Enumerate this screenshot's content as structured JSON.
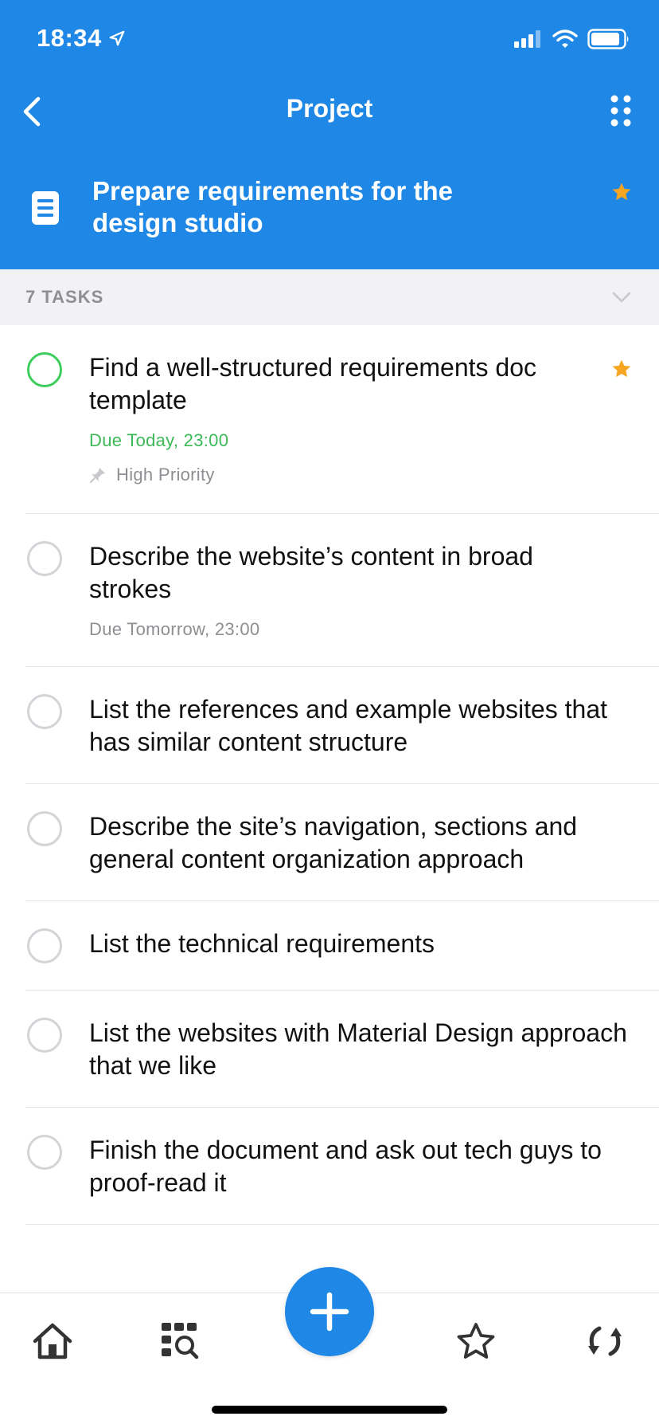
{
  "status_bar": {
    "time": "18:34"
  },
  "nav": {
    "title": "Project"
  },
  "project": {
    "title": "Prepare requirements for the design studio",
    "starred": true
  },
  "tasks_header": {
    "count_label": "7 TASKS"
  },
  "tasks": [
    {
      "text": "Find a well-structured requirements doc template",
      "due": "Due Today, 23:00",
      "priority": "High Priority",
      "starred": true
    },
    {
      "text": "Describe the website’s content in broad strokes",
      "due": "Due Tomorrow, 23:00"
    },
    {
      "text": "List the references and example websites that has similar content structure"
    },
    {
      "text": "Describe the site’s navigation, sections and general content organization approach"
    },
    {
      "text": "List the technical requirements"
    },
    {
      "text": "List the websites with Material Design approach that we like"
    },
    {
      "text": "Finish the document and ask out tech guys to proof-read it"
    }
  ],
  "tab_bar": {
    "items": [
      "home-icon",
      "search-filter-icon",
      "add-icon",
      "star-icon",
      "sync-icon"
    ]
  },
  "colors": {
    "primary": "#1f87e5",
    "accent_star": "#f6a623",
    "due_today": "#3cba57",
    "checkbox_active": "#3ccd5f"
  }
}
